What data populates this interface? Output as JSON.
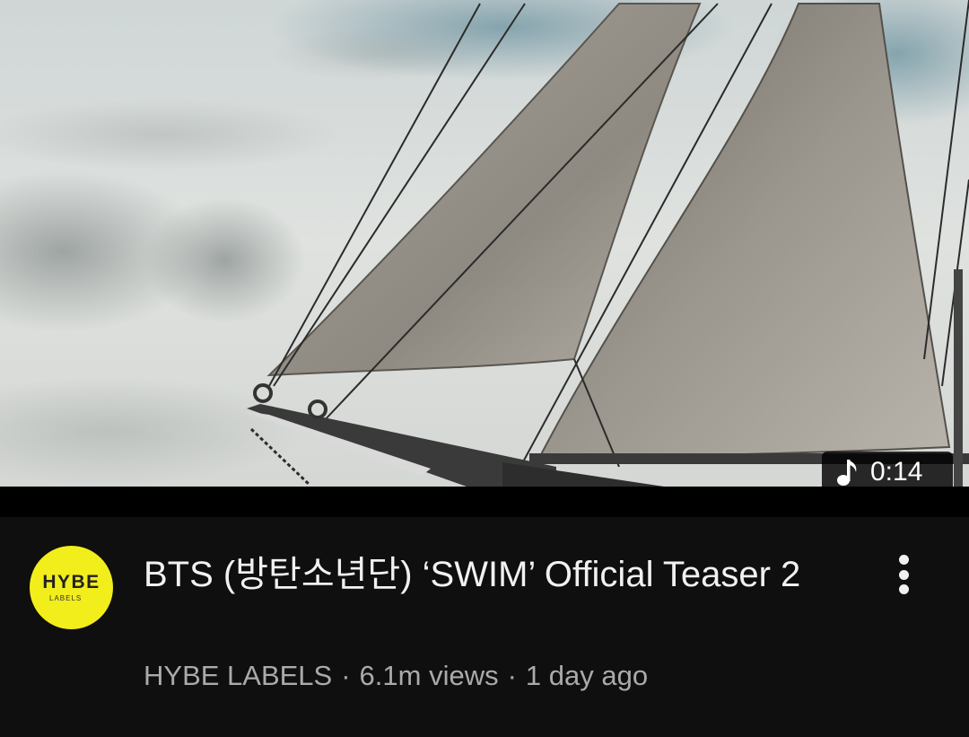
{
  "video": {
    "duration": "0:14",
    "duration_icon": "music-note-icon",
    "title": "BTS (방탄소년단) ‘SWIM’ Official Teaser 2",
    "channel": "HYBE LABELS",
    "views": "6.1m views",
    "age": "1 day ago",
    "separator": "·"
  },
  "channel_avatar": {
    "logo_text": "HYBE",
    "logo_subtext": "LABELS",
    "color": "#f2ee1b"
  },
  "more_icon": "more-vertical-icon",
  "colors": {
    "background": "#0f0f0f",
    "title": "#f1f1f1",
    "meta": "#aaaaaa"
  }
}
